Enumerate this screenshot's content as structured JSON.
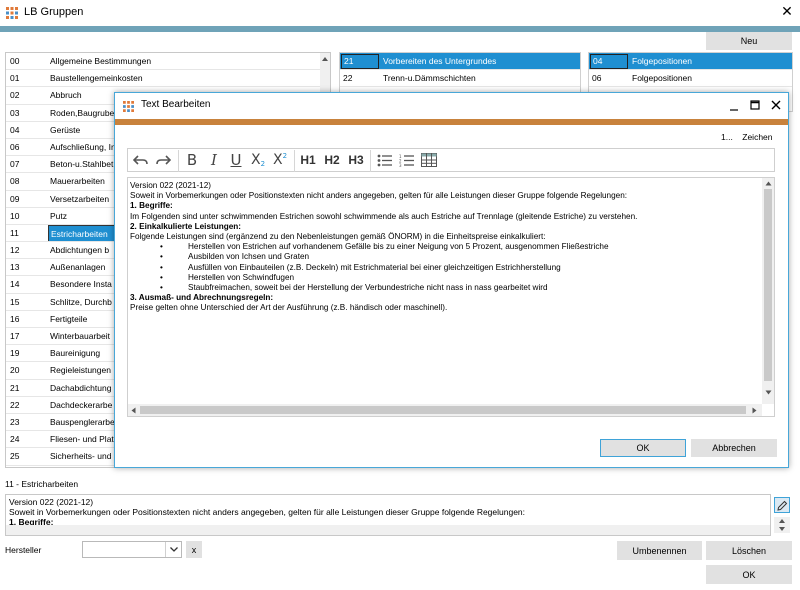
{
  "window": {
    "title": "LB Gruppen",
    "close_glyph": "✕"
  },
  "toolbar": {
    "new_label": "Neu"
  },
  "groups": [
    {
      "code": "00",
      "name": "Allgemeine Bestimmungen"
    },
    {
      "code": "01",
      "name": "Baustellengemeinkosten"
    },
    {
      "code": "02",
      "name": "Abbruch"
    },
    {
      "code": "03",
      "name": "Roden,Baugrube"
    },
    {
      "code": "04",
      "name": "Gerüste"
    },
    {
      "code": "06",
      "name": "Aufschließung, In"
    },
    {
      "code": "07",
      "name": "Beton-u.Stahlbet"
    },
    {
      "code": "08",
      "name": "Mauerarbeiten"
    },
    {
      "code": "09",
      "name": "Versetzarbeiten"
    },
    {
      "code": "10",
      "name": "Putz"
    },
    {
      "code": "11",
      "name": "Estricharbeiten"
    },
    {
      "code": "12",
      "name": "Abdichtungen b"
    },
    {
      "code": "13",
      "name": "Außenanlagen"
    },
    {
      "code": "14",
      "name": "Besondere Insta"
    },
    {
      "code": "15",
      "name": "Schlitze, Durchb"
    },
    {
      "code": "16",
      "name": "Fertigteile"
    },
    {
      "code": "17",
      "name": "Winterbauarbeit"
    },
    {
      "code": "19",
      "name": "Baureinigung"
    },
    {
      "code": "20",
      "name": "Regieleistungen"
    },
    {
      "code": "21",
      "name": "Dachabdichtung"
    },
    {
      "code": "22",
      "name": "Dachdeckerarbe"
    },
    {
      "code": "23",
      "name": "Bauspenglerarbe"
    },
    {
      "code": "24",
      "name": "Fliesen- und Plat"
    },
    {
      "code": "25",
      "name": "Sicherheits- und"
    }
  ],
  "selected_group_index": 10,
  "subgroups": [
    {
      "code": "21",
      "name": "Vorbereiten des Untergrundes"
    },
    {
      "code": "22",
      "name": "Trenn-u.Dämmschichten"
    }
  ],
  "followups": [
    {
      "code": "04",
      "name": "Folgepositionen"
    },
    {
      "code": "06",
      "name": "Folgepositionen"
    }
  ],
  "dialog": {
    "title": "Text Bearbeiten",
    "char_count": "1...",
    "char_label": "Zeichen",
    "ok_label": "OK",
    "cancel_label": "Abbrechen",
    "toolbar": [
      "undo-icon",
      "redo-icon",
      "bold-icon",
      "italic-icon",
      "underline-icon",
      "subscript-icon",
      "superscript-icon",
      "heading-1",
      "heading-2",
      "heading-3",
      "bullet-list-icon",
      "numbered-list-icon",
      "table-icon"
    ],
    "h1": "H1",
    "h2": "H2",
    "h3": "H3",
    "text": {
      "line1": "Version 022 (2021-12)",
      "line2": "Soweit in Vorbemerkungen oder Positionstexten nicht anders angegeben, gelten für alle Leistungen dieser Gruppe folgende Regelungen:",
      "h1": " 1. Begriffe:",
      "p1": "Im Folgenden sind unter schwimmenden Estrichen sowohl schwimmende als auch Estriche auf Trennlage (gleitende Estriche) zu verstehen.",
      "h2": " 2. Einkalkulierte Leistungen:",
      "p2": "Folgende Leistungen sind (ergänzend zu den Nebenleistungen gemäß ÖNORM) in die Einheitspreise einkalkuliert:",
      "items": [
        "Herstellen von Estrichen auf vorhandenem Gefälle bis zu einer Neigung von 5 Prozent, ausgenommen Fließestriche",
        "Ausbilden von Ichsen und Graten",
        "Ausfüllen von Einbauteilen (z.B. Deckeln) mit Estrichmaterial bei einer gleichzeitigen Estrichherstellung",
        "Herstellen von Schwindfugen",
        "Staubfreimachen, soweit bei der Herstellung der Verbundestriche nicht nass in nass gearbeitet wird"
      ],
      "h3": " 3. Ausmaß- und Abrechnungsregeln:",
      "p3": "Preise gelten ohne Unterschied der Art der Ausführung (z.B. händisch oder maschinell)."
    }
  },
  "section": {
    "label": "11 - Estricharbeiten"
  },
  "preview": {
    "line1": "Version 022 (2021-12)",
    "line2": "Soweit in Vorbemerkungen oder Positionstexten nicht anders angegeben, gelten für alle Leistungen dieser Gruppe folgende Regelungen:",
    "line3": " 1. Begriffe:"
  },
  "footer": {
    "hersteller_label": "Hersteller",
    "hersteller_value": "",
    "clear_label": "x",
    "rename_label": "Umbenennen",
    "delete_label": "Löschen",
    "ok_label": "OK"
  },
  "colors": {
    "accent_main": "#6fa3b8",
    "accent_dialog": "#c8823c",
    "selection": "#1f8fd1"
  }
}
